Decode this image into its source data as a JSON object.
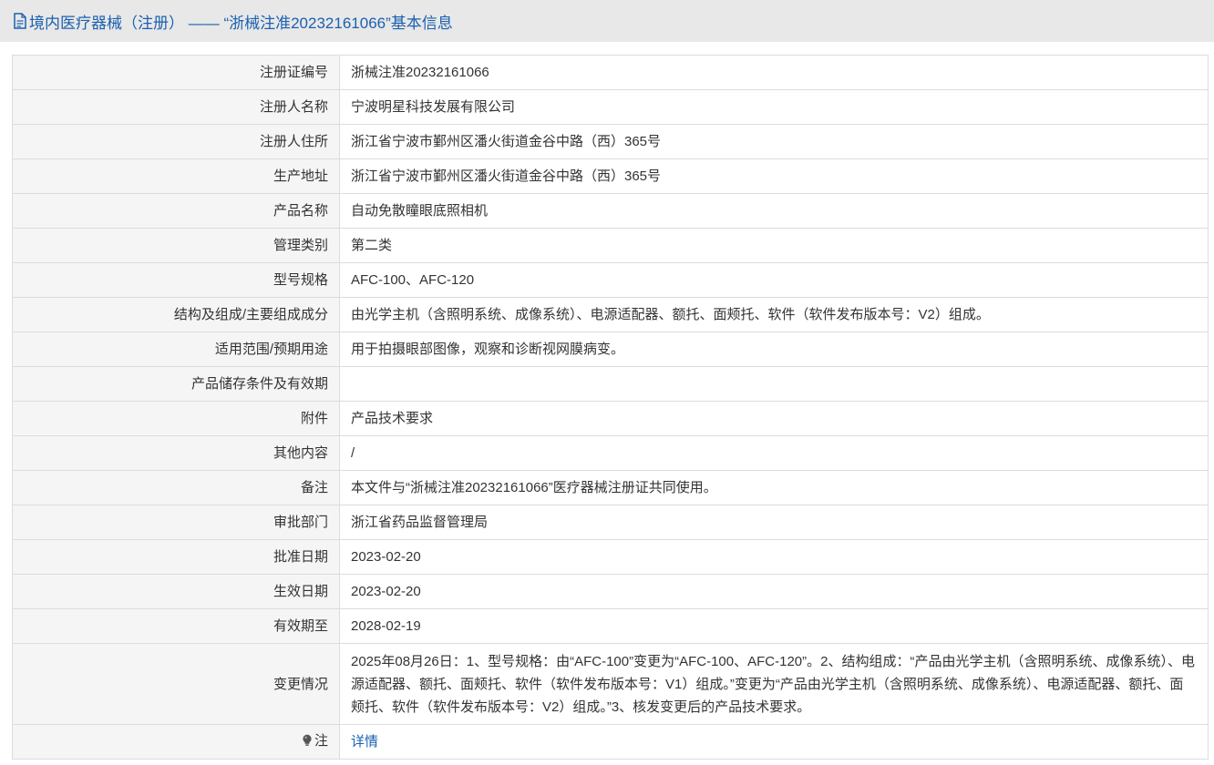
{
  "header": {
    "title": "境内医疗器械（注册） —— “浙械注准20232161066”基本信息",
    "icon": "document-icon"
  },
  "rows": [
    {
      "label": "注册证编号",
      "value": "浙械注准20232161066"
    },
    {
      "label": "注册人名称",
      "value": "宁波明星科技发展有限公司"
    },
    {
      "label": "注册人住所",
      "value": "浙江省宁波市鄞州区潘火街道金谷中路（西）365号"
    },
    {
      "label": "生产地址",
      "value": "浙江省宁波市鄞州区潘火街道金谷中路（西）365号"
    },
    {
      "label": "产品名称",
      "value": "自动免散瞳眼底照相机"
    },
    {
      "label": "管理类别",
      "value": "第二类"
    },
    {
      "label": "型号规格",
      "value": "AFC-100、AFC-120"
    },
    {
      "label": "结构及组成/主要组成成分",
      "value": "由光学主机（含照明系统、成像系统）、电源适配器、额托、面颊托、软件（软件发布版本号：V2）组成。"
    },
    {
      "label": "适用范围/预期用途",
      "value": "用于拍摄眼部图像，观察和诊断视网膜病变。"
    },
    {
      "label": "产品储存条件及有效期",
      "value": ""
    },
    {
      "label": "附件",
      "value": "产品技术要求"
    },
    {
      "label": "其他内容",
      "value": "/"
    },
    {
      "label": "备注",
      "value": "本文件与“浙械注准20232161066”医疗器械注册证共同使用。"
    },
    {
      "label": "审批部门",
      "value": "浙江省药品监督管理局"
    },
    {
      "label": "批准日期",
      "value": "2023-02-20"
    },
    {
      "label": "生效日期",
      "value": "2023-02-20"
    },
    {
      "label": "有效期至",
      "value": "2028-02-19"
    },
    {
      "label": "变更情况",
      "value": "2025年08月26日：1、型号规格：由“AFC-100”变更为“AFC-100、AFC-120”。2、结构组成：“产品由光学主机（含照明系统、成像系统）、电源适配器、额托、面颊托、软件（软件发布版本号：V1）组成。”变更为“产品由光学主机（含照明系统、成像系统）、电源适配器、额托、面颊托、软件（软件发布版本号：V2）组成。”3、核发变更后的产品技术要求。"
    }
  ],
  "note_row": {
    "label": "注",
    "icon": "lightbulb-icon",
    "link": "详情"
  },
  "colors": {
    "link": "#1a60b0",
    "header_bg": "#e8e8e8",
    "label_bg": "#f5f5f5",
    "border": "#dcdcdc"
  }
}
